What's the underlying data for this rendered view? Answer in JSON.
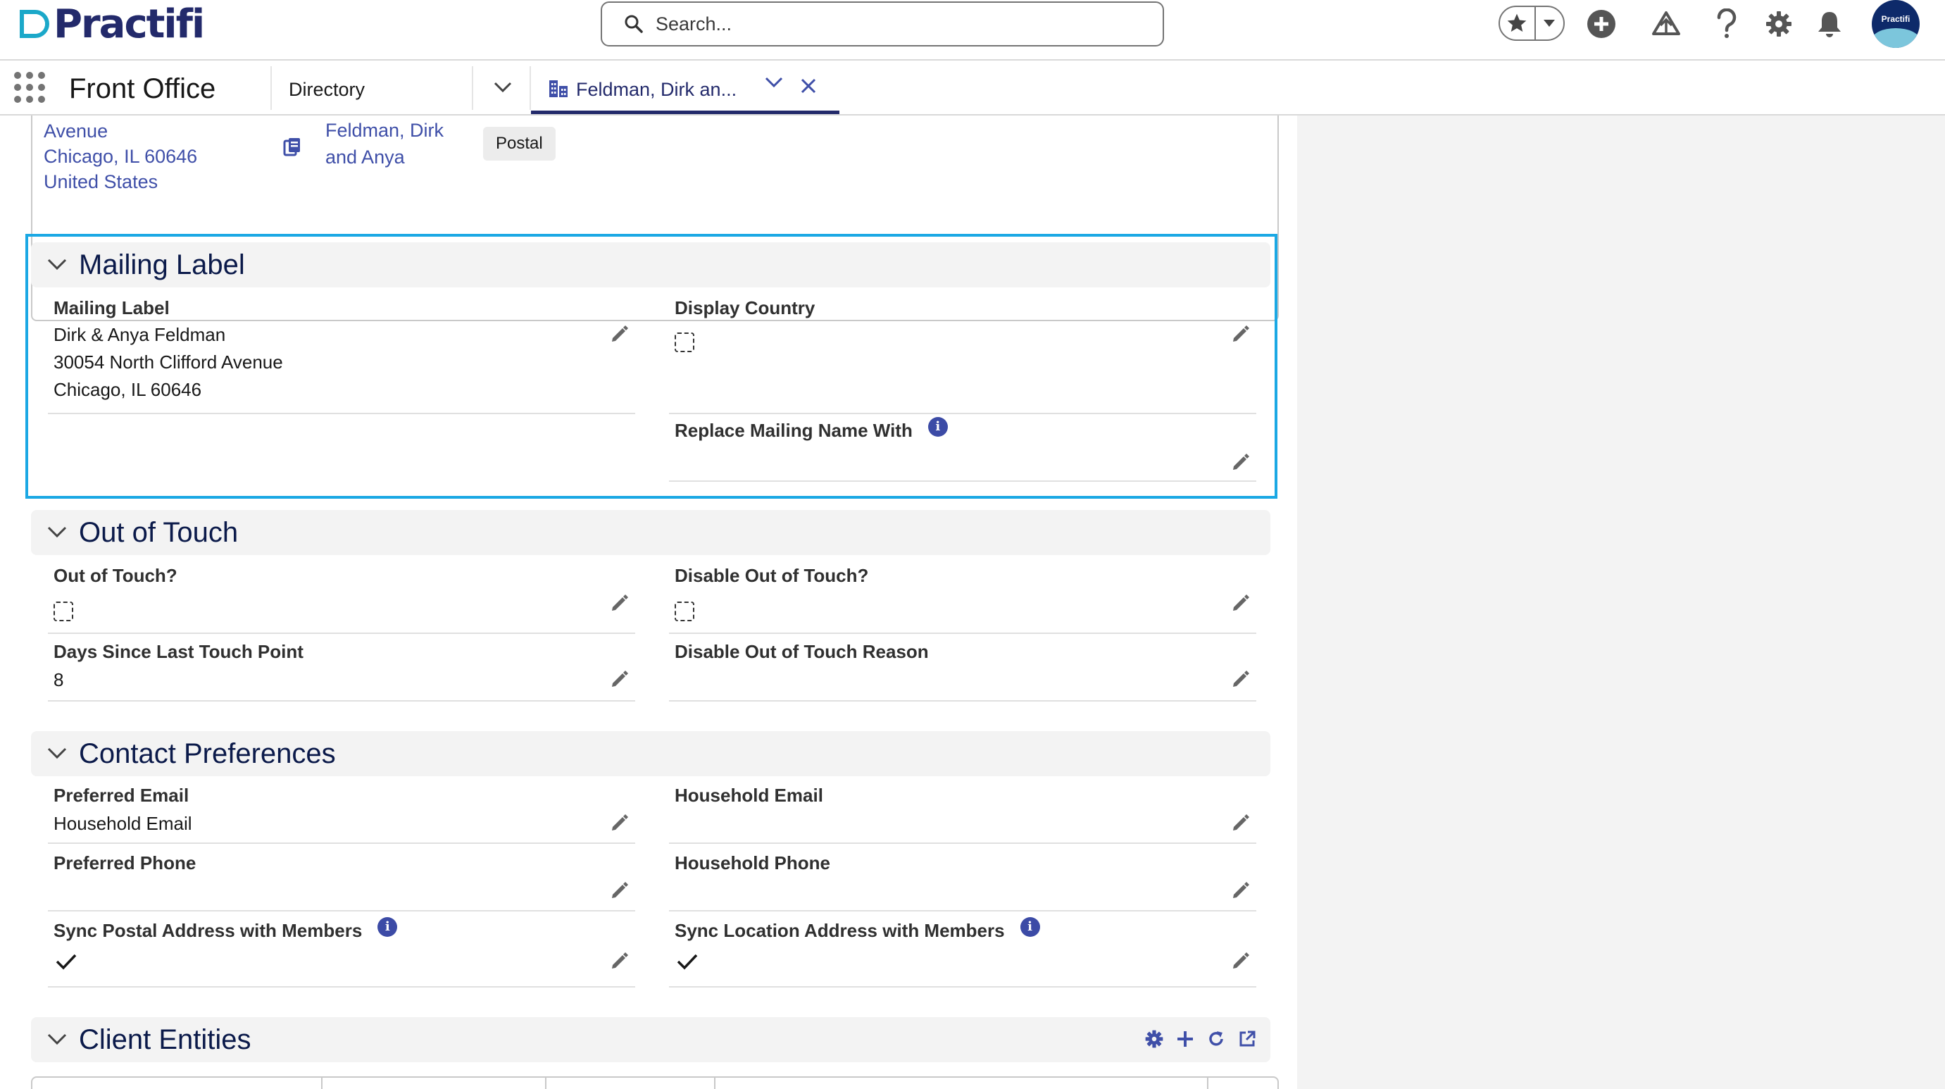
{
  "header": {
    "logo_text": "Practifi",
    "search_placeholder": "Search...",
    "avatar_text": "Practifi"
  },
  "nav": {
    "app_name": "Front Office",
    "item": "Directory",
    "tab_label": "Feldman, Dirk an..."
  },
  "address_card": {
    "lines": [
      "Avenue",
      "Chicago, IL 60646",
      "United States"
    ],
    "name_lines": [
      "Feldman, Dirk",
      "and Anya"
    ],
    "badge": "Postal"
  },
  "sections": {
    "mailing_label": {
      "title": "Mailing Label",
      "mailing_label_label": "Mailing Label",
      "mailing_label_lines": [
        "Dirk & Anya Feldman",
        "30054 North Clifford Avenue",
        "Chicago, IL 60646"
      ],
      "display_country_label": "Display Country",
      "display_country_checked": false,
      "replace_mailing_name_label": "Replace Mailing Name With",
      "replace_mailing_name_value": ""
    },
    "out_of_touch": {
      "title": "Out of Touch",
      "out_of_touch_label": "Out of Touch?",
      "out_of_touch_checked": false,
      "disable_out_of_touch_label": "Disable Out of Touch?",
      "disable_out_of_touch_checked": false,
      "days_since_label": "Days Since Last Touch Point",
      "days_since_value": "8",
      "disable_reason_label": "Disable Out of Touch Reason",
      "disable_reason_value": ""
    },
    "contact_preferences": {
      "title": "Contact Preferences",
      "preferred_email_label": "Preferred Email",
      "preferred_email_value": "Household Email",
      "household_email_label": "Household Email",
      "household_email_value": "",
      "preferred_phone_label": "Preferred Phone",
      "preferred_phone_value": "",
      "household_phone_label": "Household Phone",
      "household_phone_value": "",
      "sync_postal_label": "Sync Postal Address with Members",
      "sync_postal_checked": true,
      "sync_location_label": "Sync Location Address with Members",
      "sync_location_checked": true
    },
    "client_entities": {
      "title": "Client Entities"
    }
  },
  "colors": {
    "brand_navy": "#232a6b",
    "link_blue": "#3f4fa8",
    "focus_blue": "#1ba8e4",
    "section_bg": "#f3f3f3"
  }
}
